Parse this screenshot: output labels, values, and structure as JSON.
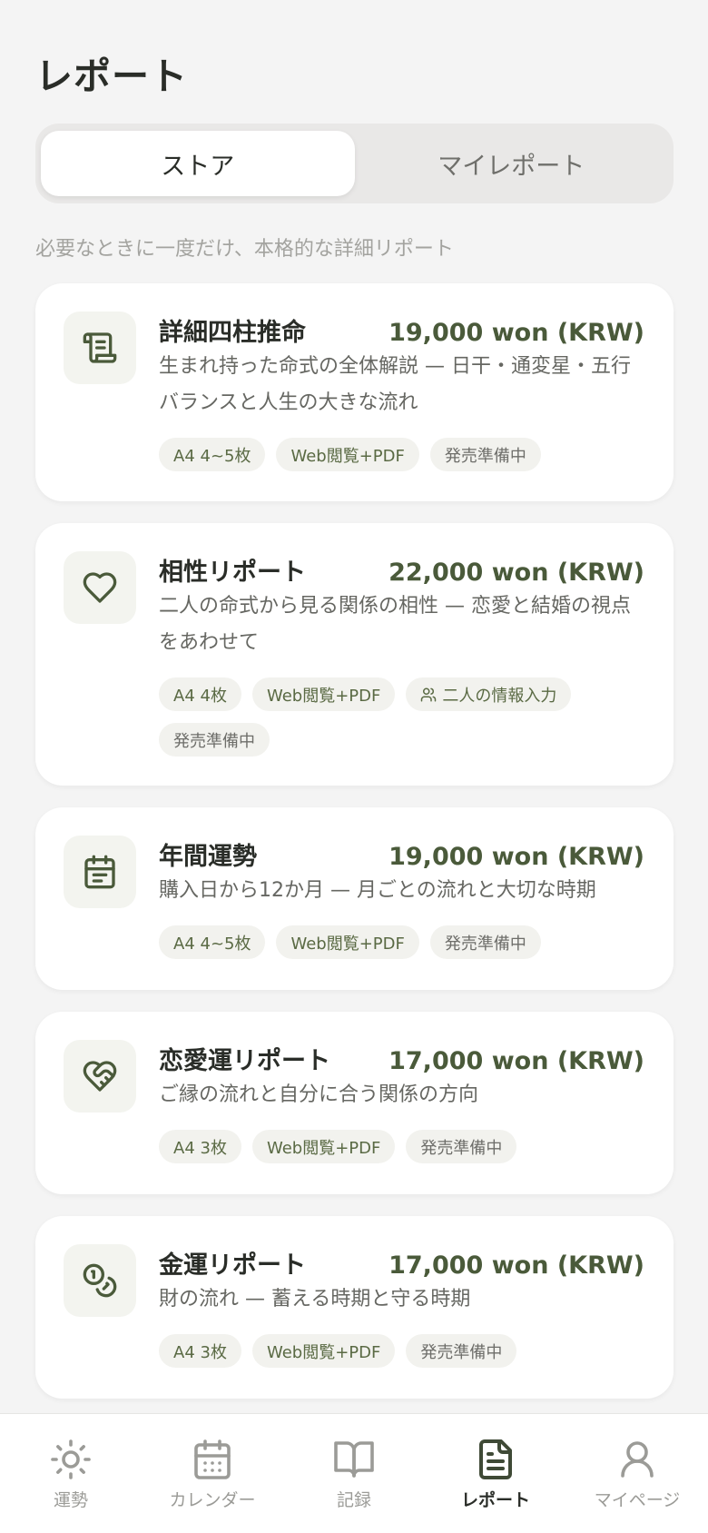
{
  "page": {
    "title": "レポート"
  },
  "tabs": [
    {
      "label": "ストア",
      "active": true
    },
    {
      "label": "マイレポート",
      "active": false
    }
  ],
  "subtitle": "必要なときに一度だけ、本格的な詳細リポート",
  "reports": [
    {
      "icon": "scroll-icon",
      "title": "詳細四柱推命",
      "price": "19,000 won (KRW)",
      "description": "生まれ持った命式の全体解説 — 日干・通変星・五行バランスと人生の大きな流れ",
      "tags": [
        "A4 4~5枚",
        "Web閲覧+PDF"
      ],
      "status": "発売準備中"
    },
    {
      "icon": "heart-icon",
      "title": "相性リポート",
      "price": "22,000 won (KRW)",
      "description": "二人の命式から見る関係の相性 — 恋愛と結婚の視点をあわせて",
      "tags": [
        "A4 4枚",
        "Web閲覧+PDF"
      ],
      "extra_tag": "二人の情報入力",
      "status": "発売準備中"
    },
    {
      "icon": "calendar-icon",
      "title": "年間運勢",
      "price": "19,000 won (KRW)",
      "description": "購入日から12か月 — 月ごとの流れと大切な時期",
      "tags": [
        "A4 4~5枚",
        "Web閲覧+PDF"
      ],
      "status": "発売準備中"
    },
    {
      "icon": "heart-handshake-icon",
      "title": "恋愛運リポート",
      "price": "17,000 won (KRW)",
      "description": "ご縁の流れと自分に合う関係の方向",
      "tags": [
        "A4 3枚",
        "Web閲覧+PDF"
      ],
      "status": "発売準備中"
    },
    {
      "icon": "coins-icon",
      "title": "金運リポート",
      "price": "17,000 won (KRW)",
      "description": "財の流れ — 蓄える時期と守る時期",
      "tags": [
        "A4 3枚",
        "Web閲覧+PDF"
      ],
      "status": "発売準備中"
    }
  ],
  "nav": [
    {
      "label": "運勢",
      "icon": "sun-icon",
      "active": false
    },
    {
      "label": "カレンダー",
      "icon": "calendar-icon",
      "active": false
    },
    {
      "label": "記録",
      "icon": "book-icon",
      "active": false
    },
    {
      "label": "レポート",
      "icon": "document-icon",
      "active": true
    },
    {
      "label": "マイページ",
      "icon": "user-icon",
      "active": false
    }
  ],
  "colors": {
    "accent": "#4a5a3a",
    "background": "#f4f4f4",
    "card": "#ffffff",
    "tag_bg": "#f2f2ee"
  }
}
